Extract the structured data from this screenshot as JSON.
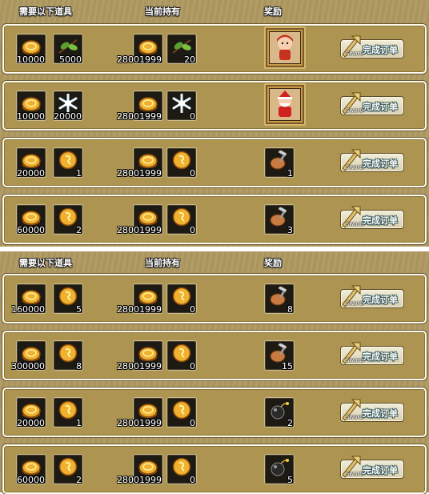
{
  "headers": {
    "required": "需要以下道具",
    "current": "当前持有",
    "reward": "奖励"
  },
  "button_label": "完成订单",
  "button_sub": "Sword",
  "colors": {
    "gold": "#e8a020",
    "leaf": "#5aa030",
    "snow": "#e0f0ff"
  },
  "rows": [
    {
      "req1": "10000",
      "req1_icon": "gold-coin",
      "req2": "5000",
      "req2_icon": "leaf",
      "have1": "28001999",
      "have2": "20",
      "reward": "",
      "reward_icon": "npc-girl-portrait"
    },
    {
      "req1": "10000",
      "req1_icon": "gold-coin",
      "req2": "20000",
      "req2_icon": "snowflake",
      "have1": "28001999",
      "have2": "0",
      "reward": "",
      "reward_icon": "npc-santa-portrait"
    },
    {
      "req1": "20000",
      "req1_icon": "gold-coin",
      "req2": "1",
      "req2_icon": "gold-token",
      "have1": "28001999",
      "have2": "0",
      "reward": "1",
      "reward_icon": "hammer-bag"
    },
    {
      "req1": "60000",
      "req1_icon": "gold-coin",
      "req2": "2",
      "req2_icon": "gold-token",
      "have1": "28001999",
      "have2": "0",
      "reward": "3",
      "reward_icon": "hammer-bag"
    },
    {
      "req1": "160000",
      "req1_icon": "gold-coin",
      "req2": "5",
      "req2_icon": "gold-token",
      "have1": "28001999",
      "have2": "0",
      "reward": "8",
      "reward_icon": "hammer-bag"
    },
    {
      "req1": "300000",
      "req1_icon": "gold-coin",
      "req2": "8",
      "req2_icon": "gold-token",
      "have1": "28001999",
      "have2": "0",
      "reward": "15",
      "reward_icon": "hammer-bag"
    },
    {
      "req1": "20000",
      "req1_icon": "gold-coin",
      "req2": "1",
      "req2_icon": "gold-token",
      "have1": "28001999",
      "have2": "0",
      "reward": "2",
      "reward_icon": "bomb"
    },
    {
      "req1": "60000",
      "req1_icon": "gold-coin",
      "req2": "2",
      "req2_icon": "gold-token",
      "have1": "28001999",
      "have2": "0",
      "reward": "5",
      "reward_icon": "bomb"
    }
  ]
}
